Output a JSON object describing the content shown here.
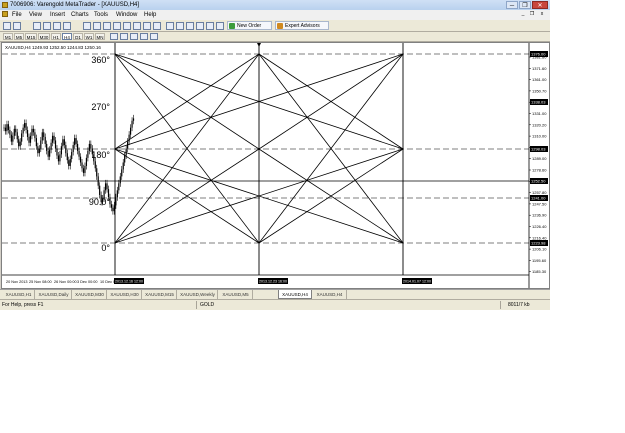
{
  "window": {
    "title": "7006906: Varengold MetaTrader - [XAUUSD,H4]",
    "controls": {
      "minimize": "─",
      "restore": "❐",
      "close": "✕"
    },
    "menu": [
      "File",
      "View",
      "Insert",
      "Charts",
      "Tools",
      "Window",
      "Help"
    ],
    "child_controls": {
      "minimize": "_",
      "restore": "❐",
      "close": "x"
    }
  },
  "toolbar": {
    "new_order": "New Order",
    "expert_advisors": "Expert Advisors",
    "icons": [
      "new-chart-icon",
      "profiles-icon",
      "market-watch-icon",
      "navigator-icon",
      "terminal-icon",
      "tester-icon",
      "new-order-icon",
      "expert-advisors-icon",
      "bar-chart-icon",
      "candle-chart-icon",
      "line-chart-icon",
      "zoom-in-icon",
      "zoom-out-icon",
      "tile-icon",
      "autoscroll-icon",
      "chart-shift-icon",
      "indicators-icon",
      "periods-icon",
      "templates-icon"
    ],
    "timeframes": [
      "M1",
      "M5",
      "M15",
      "M30",
      "H1",
      "H4",
      "D1",
      "W1",
      "MN"
    ],
    "active_timeframe": "H4"
  },
  "chart_header": "XAUUSD,H4  1249.93 1252.50 1244.83 1250.16",
  "gann_labels": [
    "360°",
    "270°",
    "180°",
    "90.0°",
    "0°"
  ],
  "price_scale": {
    "ticks": [
      "1381.80",
      "1371.60",
      "1361.00",
      "1350.70",
      "1340.20",
      "1331.00",
      "1320.20",
      "1310.00",
      "1299.50",
      "1289.00",
      "1278.60",
      "1268.10",
      "1257.80",
      "1247.50",
      "1236.90",
      "1226.40",
      "1216.40",
      "1206.10",
      "1195.60",
      "1185.30"
    ],
    "highlights": [
      {
        "text": "1376.00",
        "color": "#000000"
      },
      {
        "text": "1338.03",
        "color": "#000000"
      },
      {
        "text": "1298.03",
        "color": "#000000"
      },
      {
        "text": "1252.50",
        "color": "#000000"
      },
      {
        "text": "1241.00",
        "color": "#000000"
      },
      {
        "text": "1223.98",
        "color": "#000000"
      }
    ]
  },
  "time_scale": {
    "labels": [
      "20 Nov 2013",
      "25 Nov 08:00",
      "26 Nov 00:00",
      "3 Dec 00:00",
      "10 Dec 08:00"
    ],
    "boxed": [
      "2013.12.16 12:00",
      "2013.12.23 16:00",
      "2014.01.07 12:00"
    ]
  },
  "tabs": {
    "items": [
      "XAUUSD,H1",
      "XAUUSD,Daily",
      "XAUUSD,M30",
      "XAUUSD,H30",
      "XAUUSD,M15",
      "XAUUSD,Weekly",
      "XAUUSD,M5",
      "XAUUSD,H4",
      "XAUUSD,H4"
    ],
    "active_index": 7
  },
  "status": {
    "help": "For Help, press F1",
    "profile": "GOLD",
    "traffic": "8011/7 kb"
  },
  "colors": {
    "grid_dashed": "#555555",
    "gann": "#000000",
    "candles": "#000000"
  },
  "candle_series": [
    1312,
    1309,
    1315,
    1310,
    1306,
    1300,
    1305,
    1311,
    1308,
    1302,
    1296,
    1300,
    1307,
    1312,
    1316,
    1310,
    1304,
    1299,
    1305,
    1311,
    1308,
    1303,
    1296,
    1290,
    1294,
    1301,
    1308,
    1304,
    1298,
    1292,
    1287,
    1293,
    1299,
    1305,
    1301,
    1294,
    1288,
    1283,
    1289,
    1296,
    1302,
    1297,
    1290,
    1284,
    1279,
    1285,
    1291,
    1297,
    1303,
    1298,
    1292,
    1287,
    1282,
    1277,
    1273,
    1279,
    1286,
    1292,
    1298,
    1294,
    1289,
    1283,
    1277,
    1270,
    1262,
    1254,
    1248,
    1251,
    1258,
    1264,
    1259,
    1252,
    1246,
    1243,
    1240,
    1245,
    1252,
    1258,
    1264,
    1270,
    1276,
    1282,
    1288,
    1294,
    1300,
    1306,
    1312,
    1318,
    1320
  ]
}
